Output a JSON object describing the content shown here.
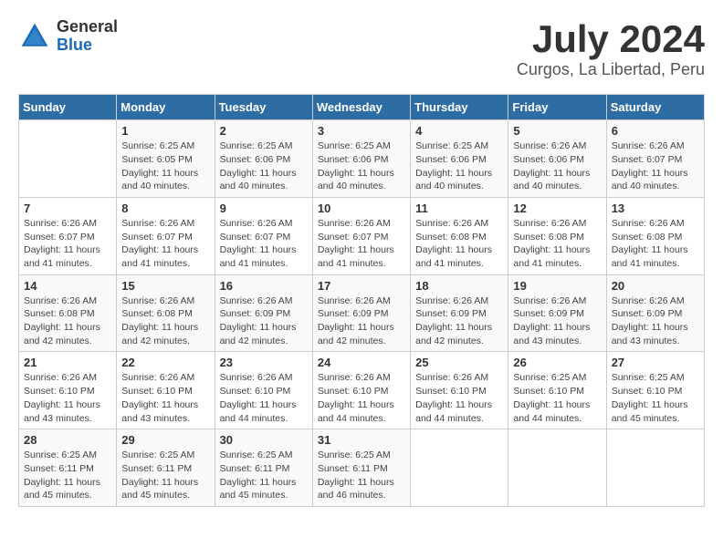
{
  "logo": {
    "general": "General",
    "blue": "Blue"
  },
  "title": "July 2024",
  "location": "Curgos, La Libertad, Peru",
  "days_of_week": [
    "Sunday",
    "Monday",
    "Tuesday",
    "Wednesday",
    "Thursday",
    "Friday",
    "Saturday"
  ],
  "weeks": [
    [
      {
        "day": "",
        "info": ""
      },
      {
        "day": "1",
        "info": "Sunrise: 6:25 AM\nSunset: 6:05 PM\nDaylight: 11 hours\nand 40 minutes."
      },
      {
        "day": "2",
        "info": "Sunrise: 6:25 AM\nSunset: 6:06 PM\nDaylight: 11 hours\nand 40 minutes."
      },
      {
        "day": "3",
        "info": "Sunrise: 6:25 AM\nSunset: 6:06 PM\nDaylight: 11 hours\nand 40 minutes."
      },
      {
        "day": "4",
        "info": "Sunrise: 6:25 AM\nSunset: 6:06 PM\nDaylight: 11 hours\nand 40 minutes."
      },
      {
        "day": "5",
        "info": "Sunrise: 6:26 AM\nSunset: 6:06 PM\nDaylight: 11 hours\nand 40 minutes."
      },
      {
        "day": "6",
        "info": "Sunrise: 6:26 AM\nSunset: 6:07 PM\nDaylight: 11 hours\nand 40 minutes."
      }
    ],
    [
      {
        "day": "7",
        "info": "Sunrise: 6:26 AM\nSunset: 6:07 PM\nDaylight: 11 hours\nand 41 minutes."
      },
      {
        "day": "8",
        "info": "Sunrise: 6:26 AM\nSunset: 6:07 PM\nDaylight: 11 hours\nand 41 minutes."
      },
      {
        "day": "9",
        "info": "Sunrise: 6:26 AM\nSunset: 6:07 PM\nDaylight: 11 hours\nand 41 minutes."
      },
      {
        "day": "10",
        "info": "Sunrise: 6:26 AM\nSunset: 6:07 PM\nDaylight: 11 hours\nand 41 minutes."
      },
      {
        "day": "11",
        "info": "Sunrise: 6:26 AM\nSunset: 6:08 PM\nDaylight: 11 hours\nand 41 minutes."
      },
      {
        "day": "12",
        "info": "Sunrise: 6:26 AM\nSunset: 6:08 PM\nDaylight: 11 hours\nand 41 minutes."
      },
      {
        "day": "13",
        "info": "Sunrise: 6:26 AM\nSunset: 6:08 PM\nDaylight: 11 hours\nand 41 minutes."
      }
    ],
    [
      {
        "day": "14",
        "info": "Sunrise: 6:26 AM\nSunset: 6:08 PM\nDaylight: 11 hours\nand 42 minutes."
      },
      {
        "day": "15",
        "info": "Sunrise: 6:26 AM\nSunset: 6:08 PM\nDaylight: 11 hours\nand 42 minutes."
      },
      {
        "day": "16",
        "info": "Sunrise: 6:26 AM\nSunset: 6:09 PM\nDaylight: 11 hours\nand 42 minutes."
      },
      {
        "day": "17",
        "info": "Sunrise: 6:26 AM\nSunset: 6:09 PM\nDaylight: 11 hours\nand 42 minutes."
      },
      {
        "day": "18",
        "info": "Sunrise: 6:26 AM\nSunset: 6:09 PM\nDaylight: 11 hours\nand 42 minutes."
      },
      {
        "day": "19",
        "info": "Sunrise: 6:26 AM\nSunset: 6:09 PM\nDaylight: 11 hours\nand 43 minutes."
      },
      {
        "day": "20",
        "info": "Sunrise: 6:26 AM\nSunset: 6:09 PM\nDaylight: 11 hours\nand 43 minutes."
      }
    ],
    [
      {
        "day": "21",
        "info": "Sunrise: 6:26 AM\nSunset: 6:10 PM\nDaylight: 11 hours\nand 43 minutes."
      },
      {
        "day": "22",
        "info": "Sunrise: 6:26 AM\nSunset: 6:10 PM\nDaylight: 11 hours\nand 43 minutes."
      },
      {
        "day": "23",
        "info": "Sunrise: 6:26 AM\nSunset: 6:10 PM\nDaylight: 11 hours\nand 44 minutes."
      },
      {
        "day": "24",
        "info": "Sunrise: 6:26 AM\nSunset: 6:10 PM\nDaylight: 11 hours\nand 44 minutes."
      },
      {
        "day": "25",
        "info": "Sunrise: 6:26 AM\nSunset: 6:10 PM\nDaylight: 11 hours\nand 44 minutes."
      },
      {
        "day": "26",
        "info": "Sunrise: 6:25 AM\nSunset: 6:10 PM\nDaylight: 11 hours\nand 44 minutes."
      },
      {
        "day": "27",
        "info": "Sunrise: 6:25 AM\nSunset: 6:10 PM\nDaylight: 11 hours\nand 45 minutes."
      }
    ],
    [
      {
        "day": "28",
        "info": "Sunrise: 6:25 AM\nSunset: 6:11 PM\nDaylight: 11 hours\nand 45 minutes."
      },
      {
        "day": "29",
        "info": "Sunrise: 6:25 AM\nSunset: 6:11 PM\nDaylight: 11 hours\nand 45 minutes."
      },
      {
        "day": "30",
        "info": "Sunrise: 6:25 AM\nSunset: 6:11 PM\nDaylight: 11 hours\nand 45 minutes."
      },
      {
        "day": "31",
        "info": "Sunrise: 6:25 AM\nSunset: 6:11 PM\nDaylight: 11 hours\nand 46 minutes."
      },
      {
        "day": "",
        "info": ""
      },
      {
        "day": "",
        "info": ""
      },
      {
        "day": "",
        "info": ""
      }
    ]
  ]
}
